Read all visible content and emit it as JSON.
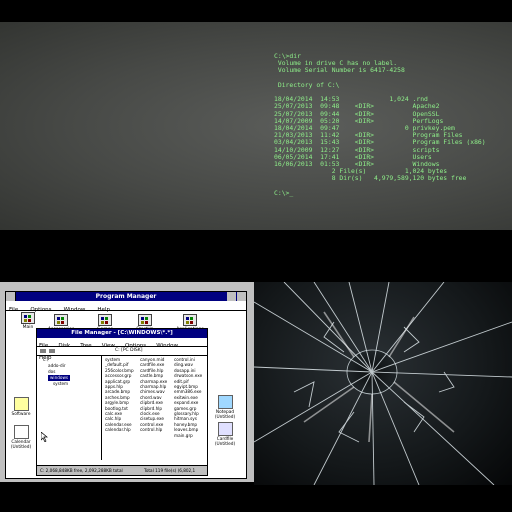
{
  "terminal": {
    "lines": [
      "C:\\>dir",
      " Volume in drive C has no label.",
      " Volume Serial Number is 6417-4258",
      "",
      " Directory of C:\\",
      "",
      "18/04/2014  14:53             1,024 .rnd",
      "25/07/2013  09:48    <DIR>          Apache2",
      "25/07/2013  09:44    <DIR>          OpenSSL",
      "14/07/2009  05:20    <DIR>          PerfLogs",
      "18/04/2014  09:47                 0 privkey.pem",
      "21/03/2013  11:42    <DIR>          Program Files",
      "03/04/2013  15:43    <DIR>          Program Files (x86)",
      "14/10/2009  12:27    <DIR>          scripts",
      "06/05/2014  17:41    <DIR>          Users",
      "16/06/2013  01:53    <DIR>          Windows",
      "               2 File(s)          1,024 bytes",
      "               8 Dir(s)   4,979,589,120 bytes free",
      "",
      "C:\\>_"
    ]
  },
  "program_manager": {
    "title": "Program Manager",
    "menu": [
      "File",
      "Options",
      "Window",
      "Help"
    ],
    "groups": [
      "Main",
      "Accessories",
      "Games",
      "StartUp",
      "Applications"
    ]
  },
  "file_manager": {
    "title": "File Manager - [C:\\WINDOWS\\*.*]",
    "menu": [
      "File",
      "Disk",
      "Tree",
      "View",
      "Options",
      "Window",
      "Help"
    ],
    "path_label": "C: [PC DISK]",
    "tree": [
      "c:\\",
      "addo-dir",
      "dos",
      "windows",
      "system"
    ],
    "col1": [
      "system",
      "_default.pif",
      "256color.bmp",
      "accessor.grp",
      "applicat.grp",
      "apps.hlp",
      "arcade.bmp",
      "arches.bmp",
      "argyle.bmp",
      "bootlog.txt",
      "calc.exe",
      "calc.hlp",
      "calendar.exe",
      "calendar.hlp"
    ],
    "col2": [
      "canyon.mid",
      "cardfile.exe",
      "cardfile.hlp",
      "castle.bmp",
      "charmap.exe",
      "charmap.hlp",
      "chimes.wav",
      "chord.wav",
      "clipbrd.exe",
      "clipbrd.hlp",
      "clock.exe",
      "cisetup.exe",
      "control.exe",
      "control.hlp"
    ],
    "col3": [
      "control.ini",
      "ding.wav",
      "dosapp.ini",
      "drwatson.exe",
      "edit.pif",
      "egyipt.bmp",
      "emm386.exe",
      "exitwin.exe",
      "expand.exe",
      "games.grp",
      "glossary.hlp",
      "hitman.sys",
      "honey.bmp",
      "leaves.bmp",
      "main.grp"
    ],
    "status_left": "C: 2,068,848KB free, 2,092,288KB total",
    "status_right": "Total 119 file(s) (6,802,1"
  },
  "desktop_icons": [
    "Software",
    "Calendar (Untitled)",
    "Notepad (Untitled)",
    "Cardfile (Untitled)"
  ]
}
